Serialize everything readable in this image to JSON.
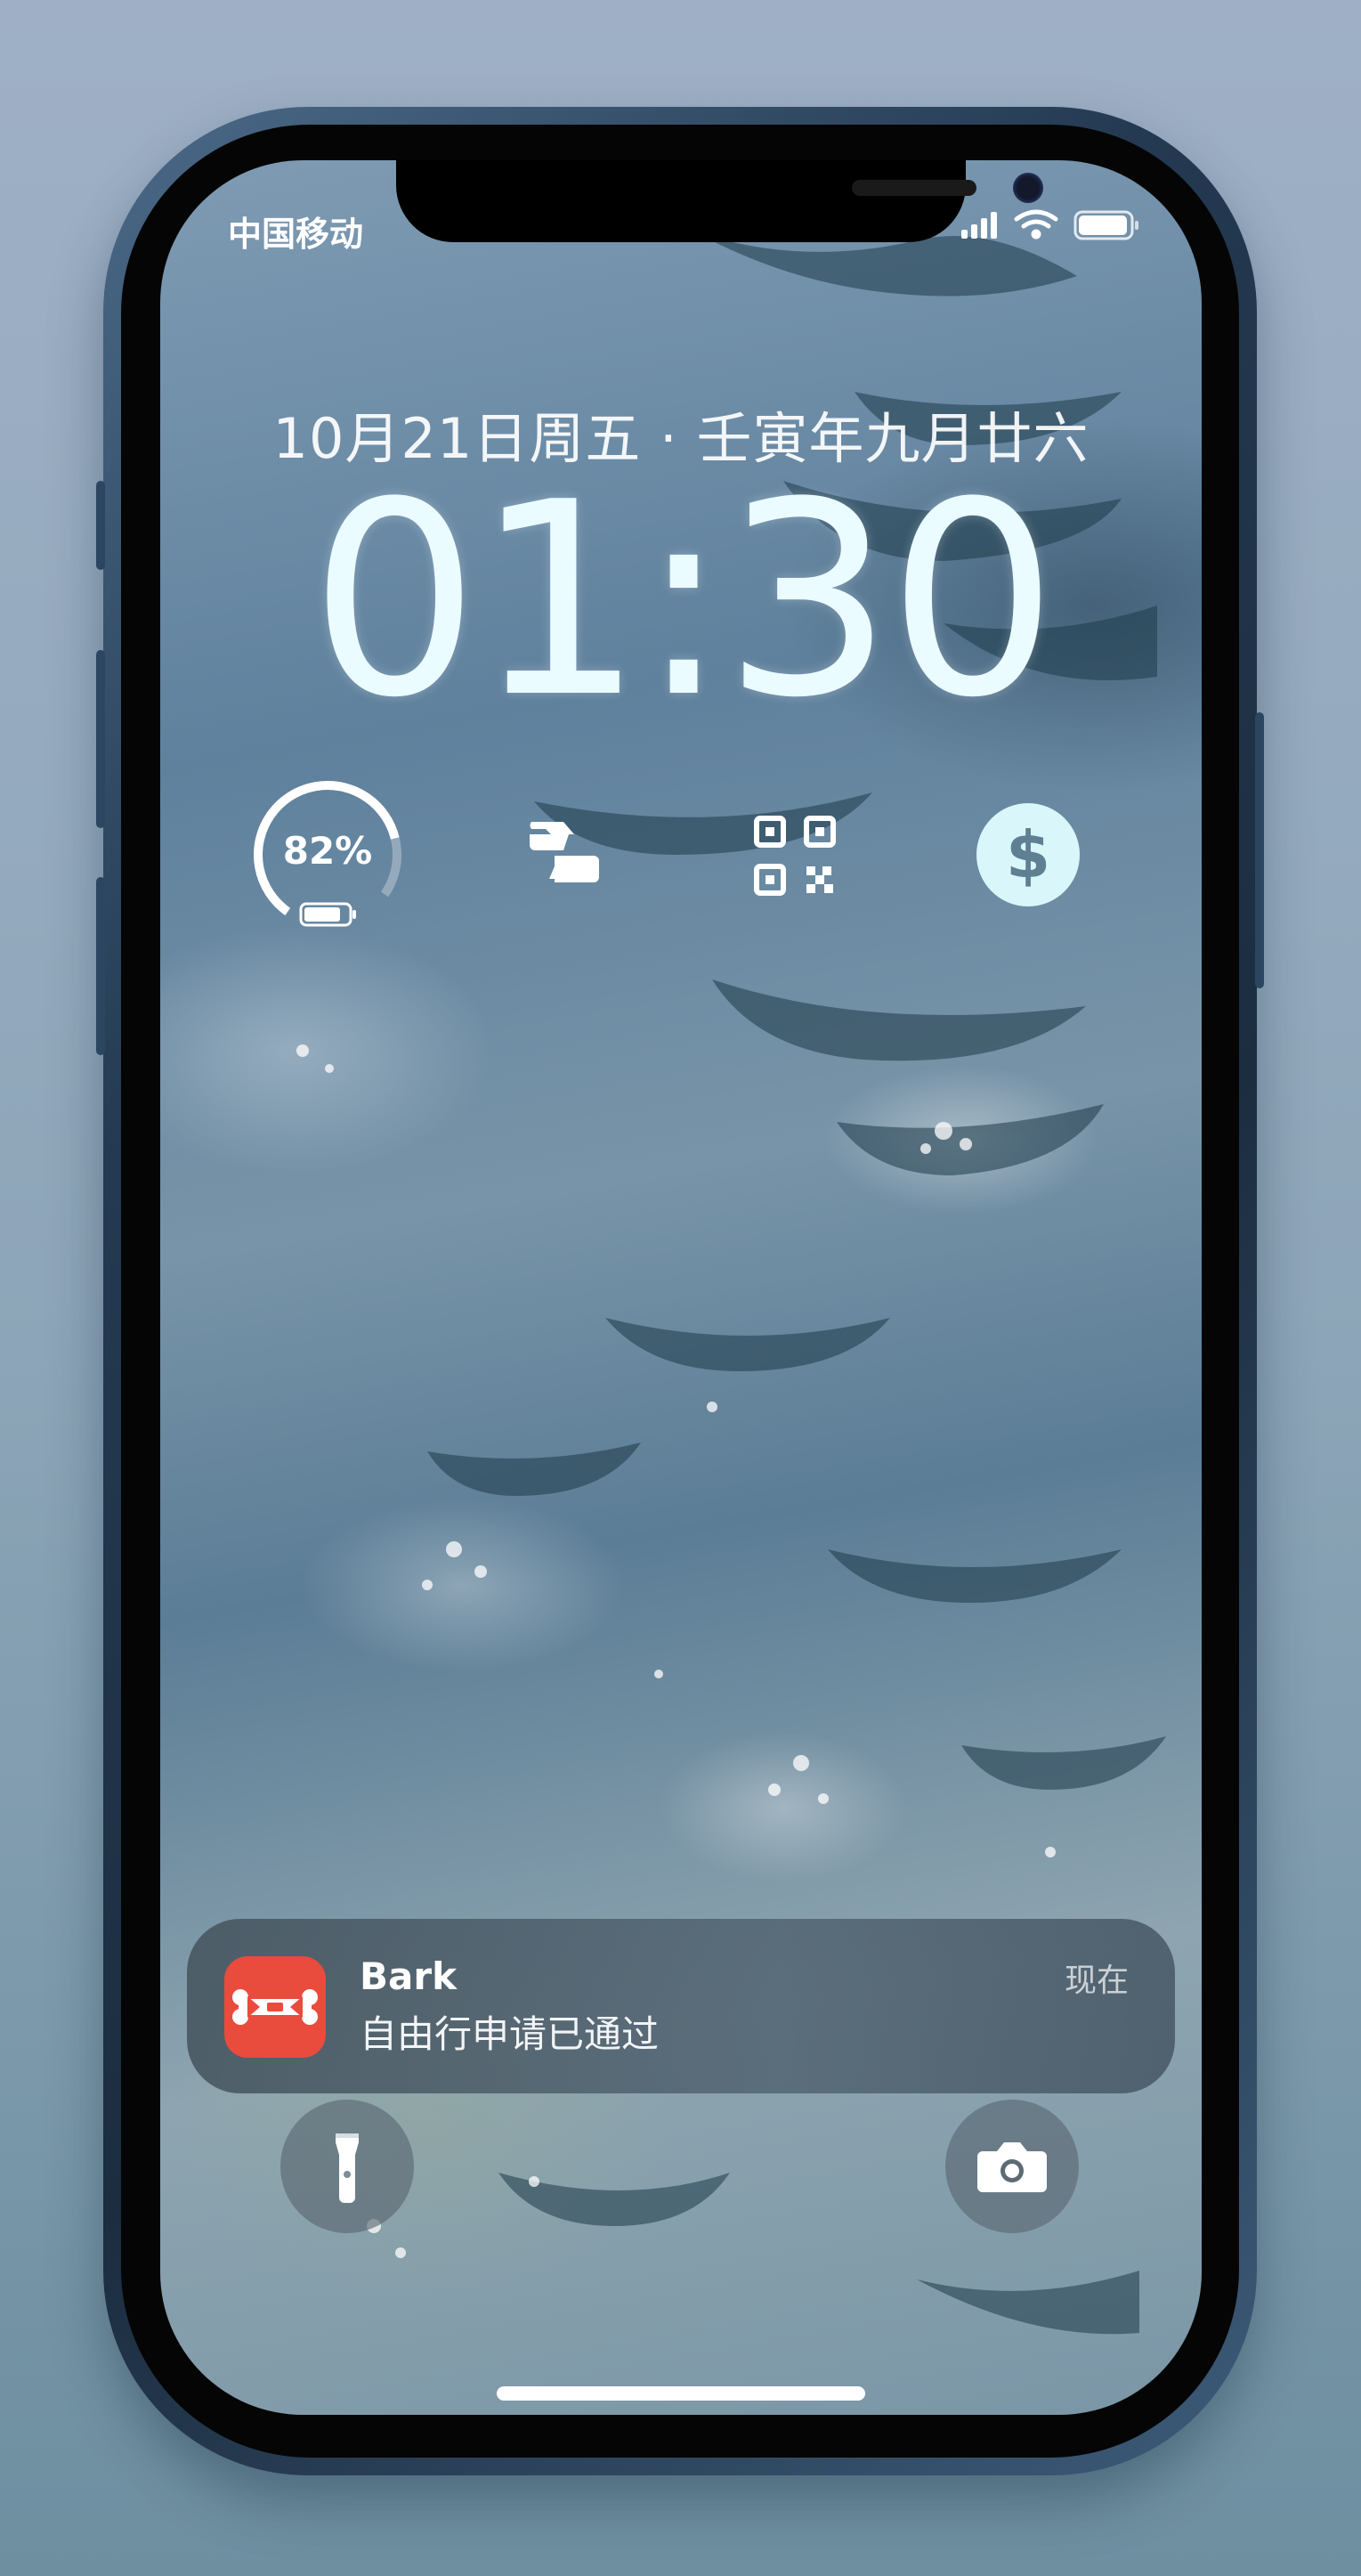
{
  "status_bar": {
    "carrier": "中国移动"
  },
  "lock_screen": {
    "date": "10月21日周五 · 壬寅年九月廿六",
    "time": "01:30"
  },
  "widgets": {
    "battery_percent": "82%",
    "battery_level": 0.82,
    "icons": [
      "battery-ring-icon",
      "switch-arrows-icon",
      "qr-code-icon",
      "dollar-icon"
    ]
  },
  "notification": {
    "app_name": "Bark",
    "message": "自由行申请已通过",
    "time": "现在"
  },
  "quick_actions": {
    "left": "flashlight-icon",
    "right": "camera-icon"
  },
  "colors": {
    "bark_red": "#e94b3c",
    "time_color": "#eafcff",
    "dollar_bg": "#d9f6fb"
  }
}
